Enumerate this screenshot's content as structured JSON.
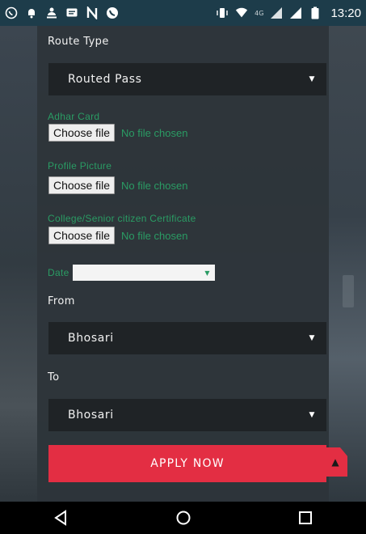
{
  "status_bar": {
    "time": "13:20",
    "network_label": "4G",
    "icons": [
      "whatsapp-icon",
      "notification-icon",
      "users-icon",
      "message-icon",
      "n-icon",
      "phone-icon",
      "vibrate-icon",
      "wifi-icon",
      "signal-icon",
      "signal-icon",
      "battery-icon"
    ]
  },
  "form": {
    "route_type": {
      "label": "Route Type",
      "value": "Routed Pass"
    },
    "aadhar": {
      "label": "Adhar Card",
      "button": "Choose file",
      "status": "No file chosen"
    },
    "profile_picture": {
      "label": "Profile Picture",
      "button": "Choose file",
      "status": "No file chosen"
    },
    "certificate": {
      "label": "College/Senior citizen Certificate",
      "button": "Choose file",
      "status": "No file chosen"
    },
    "date": {
      "label": "Date"
    },
    "from": {
      "label": "From",
      "value": "Bhosari"
    },
    "to": {
      "label": "To",
      "value": "Bhosari"
    },
    "apply_label": "APPLY NOW"
  },
  "colors": {
    "accent": "#e32e43",
    "green_label": "#2a9c64",
    "select_bg": "#1f2326"
  }
}
